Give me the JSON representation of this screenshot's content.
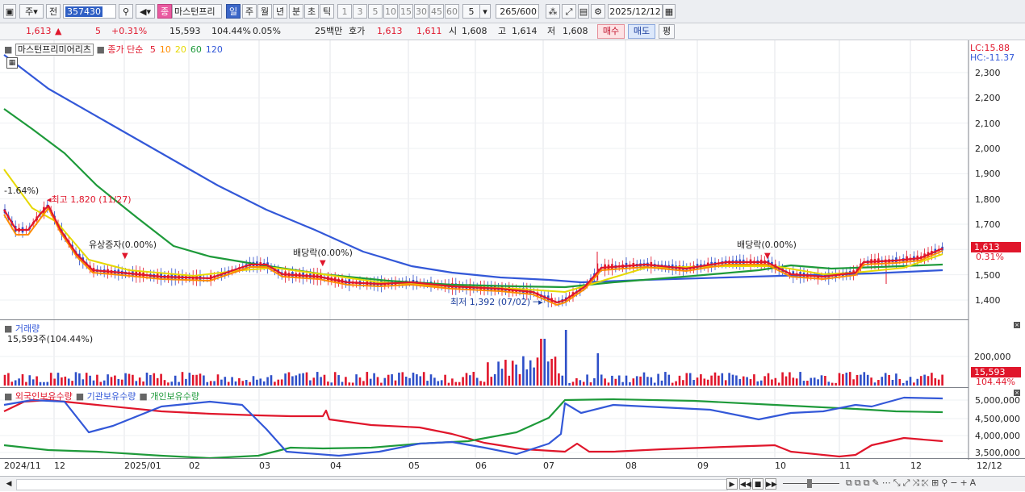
{
  "toolbar": {
    "period_select": "주",
    "prev_label": "전",
    "stock_code": "357430",
    "stock_name": "마스턴프리",
    "type_badge": "종",
    "interval_tabs": [
      "일",
      "주",
      "월",
      "년",
      "분",
      "초",
      "틱"
    ],
    "selected_interval": "일",
    "presets": [
      "1",
      "3",
      "5",
      "10",
      "15",
      "30",
      "45",
      "60"
    ],
    "preset_value": "5",
    "count_value": "265",
    "count_total": "/600",
    "date_value": "2025/12/12"
  },
  "quote": {
    "price": "1,613",
    "change": "5",
    "change_pct": "+0.31%",
    "volume": "15,593",
    "volume_ratio": "104.44%",
    "turnover": "0.05%",
    "amount": "25백만",
    "ask_label": "호가",
    "ask": "1,613",
    "bid": "1,611",
    "open_label": "시",
    "open": "1,608",
    "high_label": "고",
    "high": "1,614",
    "low_label": "저",
    "low": "1,608",
    "buy_btn": "매수",
    "sell_btn": "매도",
    "eval_btn": "평"
  },
  "chart": {
    "stock_legend": "마스턴프리미어리츠",
    "ma_title": "종가 단순",
    "ma_periods": [
      {
        "label": "5",
        "color": "#e0162b"
      },
      {
        "label": "10",
        "color": "#ff8c00"
      },
      {
        "label": "20",
        "color": "#e6d800"
      },
      {
        "label": "60",
        "color": "#1e9a3a"
      },
      {
        "label": "120",
        "color": "#3358d8"
      }
    ],
    "lc_label": "LC:15.88",
    "hc_label": "HC:-11.37",
    "price_ticks": [
      "2,300",
      "2,200",
      "2,100",
      "2,000",
      "1,900",
      "1,800",
      "1,700",
      "1,600",
      "1,500",
      "1,400"
    ],
    "current_price_tag": "1,613",
    "current_pct_tag": "0.31%",
    "annotations": {
      "left_pct": "-1.64%)",
      "high": "최고 1,820 (11/27)",
      "rights_issue": "유상증자(0.00%)",
      "dividend1": "배당락(0.00%)",
      "low": "최저 1,392 (07/02)",
      "dividend2": "배당락(0.00%)"
    },
    "volume_title": "거래량",
    "volume_sub": "15,593주(104.44%)",
    "volume_tick": "200,000",
    "volume_tag": "15,593",
    "volume_pct_tag": "104.44%",
    "holdings_titles": [
      "외국인보유수량",
      "기관보유수량",
      "개인보유수량"
    ],
    "holdings_colors": [
      "#e0162b",
      "#3358d8",
      "#1e9a3a"
    ],
    "holdings_ticks": [
      "5,000,000",
      "4,500,000",
      "4,000,000",
      "3,500,000"
    ],
    "x_labels": [
      "2024/11",
      "12",
      "2025/01",
      "02",
      "03",
      "04",
      "05",
      "06",
      "07",
      "08",
      "09",
      "10",
      "11",
      "12"
    ],
    "x_right_label": "12/12"
  }
}
